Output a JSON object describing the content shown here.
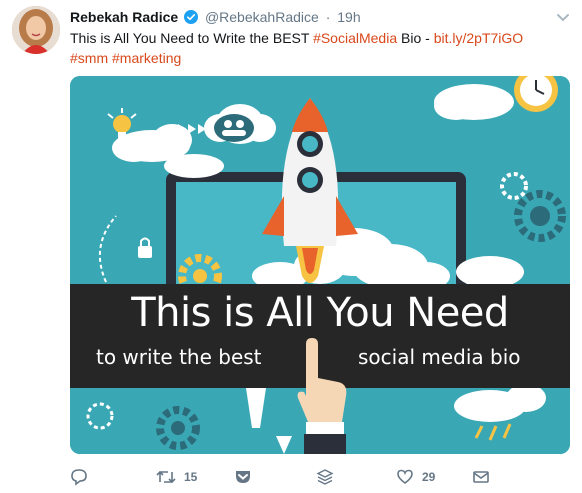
{
  "tweet": {
    "author_name": "Rebekah Radice",
    "handle": "@RebekahRadice",
    "separator": "·",
    "time": "19h",
    "text_lead": "This is All You Need to Write the BEST ",
    "hashtag_social": "#SocialMedia",
    "text_mid": " Bio - ",
    "link": "bit.ly/2pT7iGO",
    "hashtag_smm": "#smm",
    "hashtag_marketing": "#marketing"
  },
  "media": {
    "title": "This is All You Need",
    "subtitle_left": "to write the best",
    "subtitle_right": "social media bio"
  },
  "actions": {
    "retweet_count": "15",
    "like_count": "29"
  },
  "colors": {
    "accent": "#d9481c",
    "muted": "#657786",
    "verified": "#1da1f2",
    "media_bg": "#3aa7b5",
    "banner": "#262626"
  }
}
